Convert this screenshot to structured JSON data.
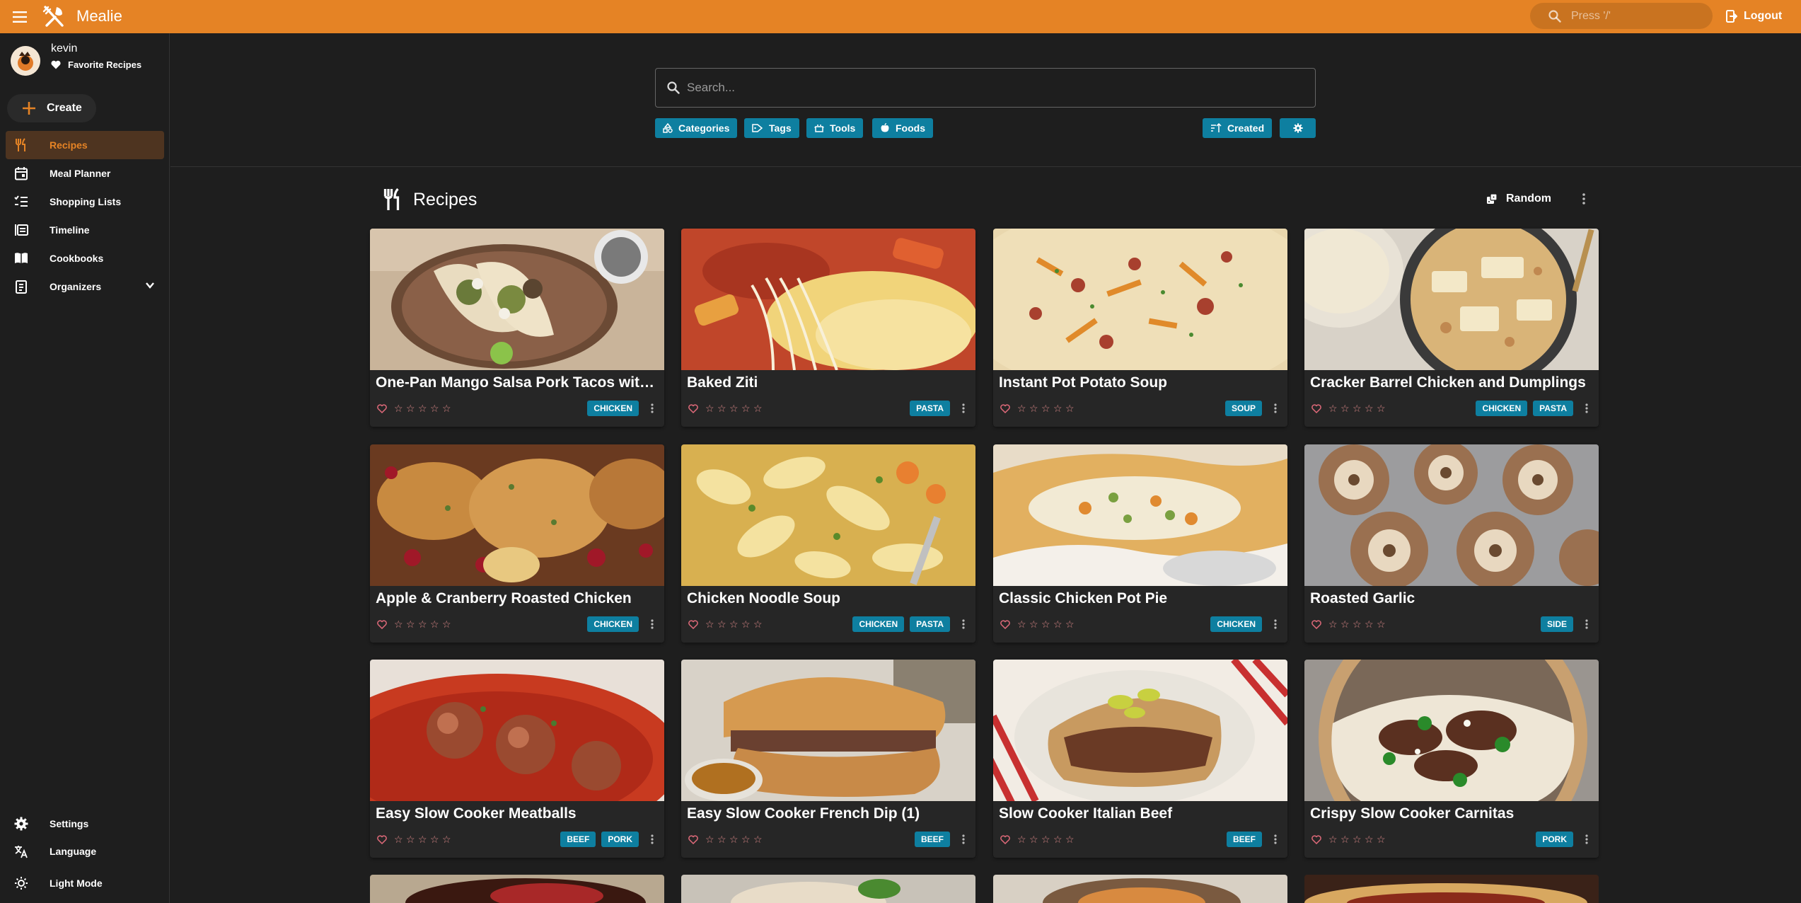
{
  "app": {
    "brand": "Mealie"
  },
  "topbar": {
    "search_placeholder": "Press '/'",
    "logout_label": "Logout"
  },
  "user": {
    "name": "kevin",
    "favorites_label": "Favorite Recipes"
  },
  "sidebar": {
    "create_label": "Create",
    "items": [
      {
        "label": "Recipes",
        "icon": "fork-knife-icon",
        "active": true
      },
      {
        "label": "Meal Planner",
        "icon": "calendar-icon"
      },
      {
        "label": "Shopping Lists",
        "icon": "checklist-icon"
      },
      {
        "label": "Timeline",
        "icon": "timeline-icon"
      },
      {
        "label": "Cookbooks",
        "icon": "book-icon"
      },
      {
        "label": "Organizers",
        "icon": "clipboard-icon"
      }
    ],
    "bottom": [
      {
        "label": "Settings",
        "icon": "gear-icon"
      },
      {
        "label": "Language",
        "icon": "translate-icon"
      },
      {
        "label": "Light Mode",
        "icon": "sun-icon"
      }
    ]
  },
  "search": {
    "placeholder": "Search..."
  },
  "filters": {
    "categories": "Categories",
    "tags": "Tags",
    "tools": "Tools",
    "foods": "Foods",
    "sort": "Created"
  },
  "section": {
    "title": "Recipes",
    "random_label": "Random"
  },
  "colors": {
    "accent": "#e58325",
    "tag": "#0e7fa0",
    "background": "#1e1e1e",
    "card": "#262626"
  },
  "recipes": [
    {
      "title": "One-Pan Mango Salsa Pork Tacos with Cil...",
      "tags": [
        "CHICKEN"
      ]
    },
    {
      "title": "Baked Ziti",
      "tags": [
        "PASTA"
      ]
    },
    {
      "title": "Instant Pot Potato Soup",
      "tags": [
        "SOUP"
      ]
    },
    {
      "title": "Cracker Barrel Chicken and Dumplings",
      "tags": [
        "CHICKEN",
        "PASTA"
      ]
    },
    {
      "title": "Apple & Cranberry Roasted Chicken",
      "tags": [
        "CHICKEN"
      ]
    },
    {
      "title": "Chicken Noodle Soup",
      "tags": [
        "CHICKEN",
        "PASTA"
      ]
    },
    {
      "title": "Classic Chicken Pot Pie",
      "tags": [
        "CHICKEN"
      ]
    },
    {
      "title": "Roasted Garlic",
      "tags": [
        "SIDE"
      ]
    },
    {
      "title": "Easy Slow Cooker Meatballs",
      "tags": [
        "BEEF",
        "PORK"
      ]
    },
    {
      "title": "Easy Slow Cooker French Dip (1)",
      "tags": [
        "BEEF"
      ]
    },
    {
      "title": "Slow Cooker Italian Beef",
      "tags": [
        "BEEF"
      ]
    },
    {
      "title": "Crispy Slow Cooker Carnitas",
      "tags": [
        "PORK"
      ]
    }
  ]
}
